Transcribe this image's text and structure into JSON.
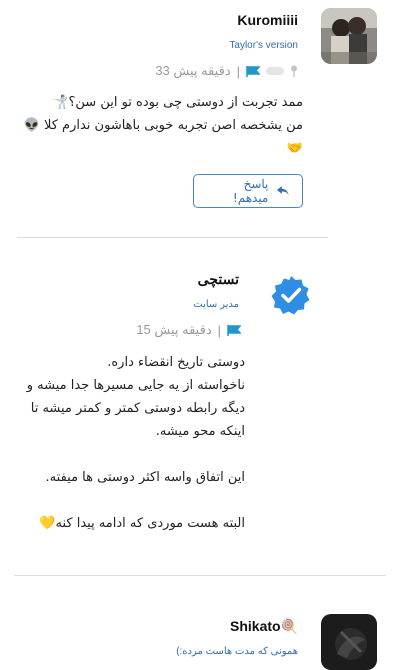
{
  "comments": [
    {
      "author": "Kuromiiii",
      "role": "Taylor's version",
      "time": "33 دقیقه پیش",
      "text": "ممد تجربت از دوستی چی بوده تو این سن؟🤺\nمن یشخصه اصن تجربه خوبی باهاشون ندارم کلا 👽\n🤝",
      "reply_label": "پاسخ میدهم!"
    },
    {
      "author": "تستچی",
      "role": "مدیر سایت",
      "time": "15 دقیقه پیش",
      "text": "دوستی تاریخ انقضاء داره.\nناخواسته از یه جایی مسیرها جدا میشه و\nدیگه رابطه دوستی کمتر و کمتر میشه تا\nاینکه محو میشه.\n\nاین اتفاق واسه اکثر دوستی ها میفته.\n\nالبته هست موردی که ادامه پیدا کنه💛"
    },
    {
      "author": "Shikato🍭",
      "role": "همونی که مدت هاست مرده:)"
    }
  ],
  "meta_separator": "|",
  "colors": {
    "accent": "#2f6fb3",
    "verified": "#2f8de4",
    "flag": "#2196c9"
  }
}
